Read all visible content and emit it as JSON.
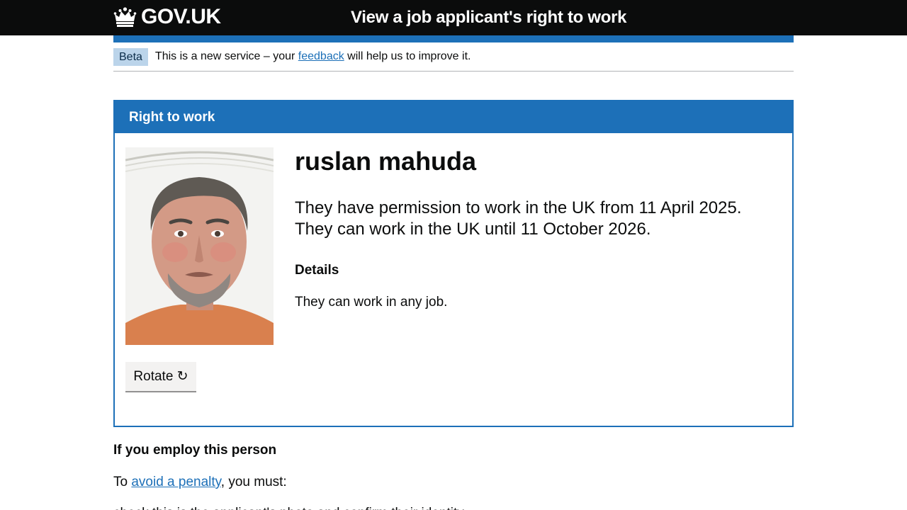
{
  "header": {
    "logo_text": "GOV.UK",
    "service_name": "View a job applicant's right to work",
    "logo_icon": "crown-icon"
  },
  "phase_banner": {
    "tag": "Beta",
    "text_before": "This is a new service – your",
    "link_text": "feedback",
    "text_after": "will help us to improve it."
  },
  "card": {
    "title": "Right to work",
    "name": "ruslan mahuda",
    "permission_line1": "They have permission to work in the UK from 11 April 2025.",
    "permission_line2": "They can work in the UK until 11 October 2026.",
    "details_heading": "Details",
    "details_text": "They can work in any job.",
    "rotate_label": "Rotate ↻"
  },
  "employ": {
    "heading": "If you employ this person",
    "penalty_prefix": "To",
    "penalty_link": "avoid a penalty",
    "penalty_suffix": ", you must:",
    "cut_text": "check this is the applicant's photo and confirm their identity"
  },
  "colors": {
    "header_bg": "#0b0c0c",
    "brand_blue": "#1d70b8",
    "beta_tag_bg": "#bbd4ea",
    "link": "#1d70b8"
  }
}
